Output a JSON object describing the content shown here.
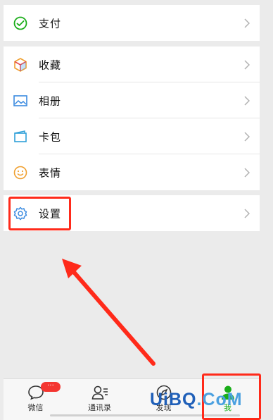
{
  "menu": {
    "pay": {
      "label": "支付",
      "icon": "pay-icon"
    },
    "favorites": {
      "label": "收藏",
      "icon": "cube-icon"
    },
    "album": {
      "label": "相册",
      "icon": "image-icon"
    },
    "cards": {
      "label": "卡包",
      "icon": "wallet-icon"
    },
    "stickers": {
      "label": "表情",
      "icon": "smiley-icon"
    },
    "settings": {
      "label": "设置",
      "icon": "gear-icon"
    }
  },
  "tabbar": {
    "chats": {
      "label": "微信",
      "badge": "···"
    },
    "contacts": {
      "label": "通讯录"
    },
    "discover": {
      "label": "发现"
    },
    "me": {
      "label": "我"
    }
  },
  "watermark": {
    "part1": "UiBQ",
    "part2": ".CoM"
  },
  "colors": {
    "accent_green": "#1aad19",
    "annotation_red": "#ff2a1a",
    "badge_red": "#f43530"
  }
}
